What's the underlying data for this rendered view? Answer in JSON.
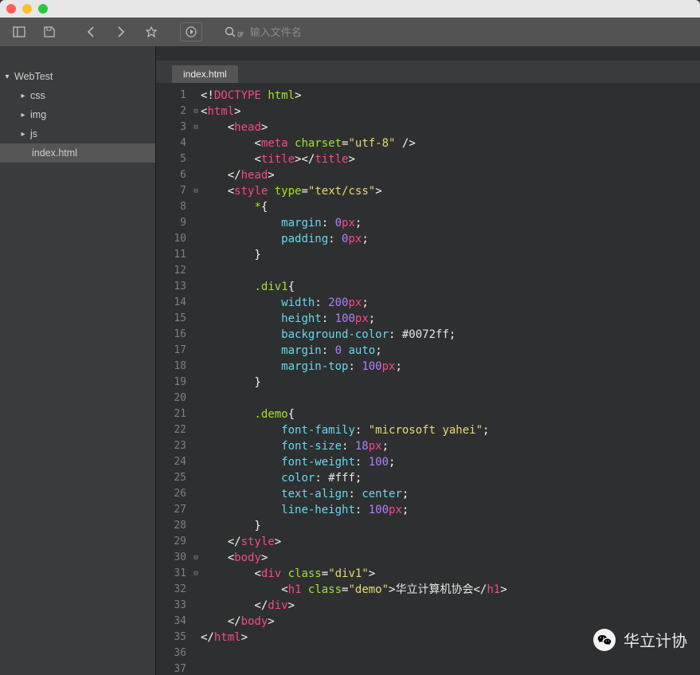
{
  "toolbar": {
    "search_prefix": "QF",
    "search_placeholder": "输入文件名"
  },
  "sidebar": {
    "project": "WebTest",
    "items": [
      "css",
      "img",
      "js"
    ],
    "file": "index.html"
  },
  "tab": {
    "label": "index.html"
  },
  "code": {
    "lines": [
      {
        "n": 1,
        "fold": "",
        "html": "<span class='w'>&lt;!</span><span class='tg'>DOCTYPE</span><span class='w'> </span><span class='at'>html</span><span class='w'>&gt;</span>"
      },
      {
        "n": 2,
        "fold": "⊟",
        "html": "<span class='w'>&lt;</span><span class='tg'>html</span><span class='w'>&gt;</span>"
      },
      {
        "n": 3,
        "fold": "⊟",
        "html": "<span class='w'>    &lt;</span><span class='tg'>head</span><span class='w'>&gt;</span>"
      },
      {
        "n": 4,
        "fold": "",
        "html": "<span class='w'>        &lt;</span><span class='tg'>meta</span><span class='w'> </span><span class='at'>charset</span><span class='w'>=</span><span class='st'>\"utf-8\"</span><span class='w'> /&gt;</span>"
      },
      {
        "n": 5,
        "fold": "",
        "html": "<span class='w'>        &lt;</span><span class='tg'>title</span><span class='w'>&gt;&lt;/</span><span class='tg'>title</span><span class='w'>&gt;</span>"
      },
      {
        "n": 6,
        "fold": "",
        "html": "<span class='w'>    &lt;/</span><span class='tg'>head</span><span class='w'>&gt;</span>"
      },
      {
        "n": 7,
        "fold": "⊟",
        "html": "<span class='w'>    &lt;</span><span class='tg'>style</span><span class='w'> </span><span class='at'>type</span><span class='w'>=</span><span class='st'>\"text/css\"</span><span class='w'>&gt;</span>"
      },
      {
        "n": 8,
        "fold": "",
        "html": "<span class='w'>        </span><span class='sel'>*</span><span class='w'>{</span>"
      },
      {
        "n": 9,
        "fold": "",
        "html": "<span class='w'>            </span><span class='prop'>margin</span><span class='w'>: </span><span class='num'>0</span><span class='kw'>px</span><span class='w'>;</span>"
      },
      {
        "n": 10,
        "fold": "",
        "html": "<span class='w'>            </span><span class='prop'>padding</span><span class='w'>: </span><span class='num'>0</span><span class='kw'>px</span><span class='w'>;</span>"
      },
      {
        "n": 11,
        "fold": "",
        "html": "<span class='w'>        }</span>"
      },
      {
        "n": 12,
        "fold": "",
        "html": "<span class='w'>        </span>"
      },
      {
        "n": 13,
        "fold": "",
        "html": "<span class='w'>        </span><span class='sel'>.div1</span><span class='w'>{</span>"
      },
      {
        "n": 14,
        "fold": "",
        "html": "<span class='w'>            </span><span class='prop'>width</span><span class='w'>: </span><span class='num'>200</span><span class='kw'>px</span><span class='w'>;</span>"
      },
      {
        "n": 15,
        "fold": "",
        "html": "<span class='w'>            </span><span class='prop'>height</span><span class='w'>: </span><span class='num'>100</span><span class='kw'>px</span><span class='w'>;</span>"
      },
      {
        "n": 16,
        "fold": "",
        "html": "<span class='w'>            </span><span class='prop'>background-color</span><span class='w'>: </span><span class='col'>#0072ff</span><span class='w'>;</span>"
      },
      {
        "n": 17,
        "fold": "",
        "html": "<span class='w'>            </span><span class='prop'>margin</span><span class='w'>: </span><span class='num'>0</span><span class='w'> </span><span class='prop'>auto</span><span class='w'>;</span>"
      },
      {
        "n": 18,
        "fold": "",
        "html": "<span class='w'>            </span><span class='prop'>margin-top</span><span class='w'>: </span><span class='num'>100</span><span class='kw'>px</span><span class='w'>;</span>"
      },
      {
        "n": 19,
        "fold": "",
        "html": "<span class='w'>        }</span>"
      },
      {
        "n": 20,
        "fold": "",
        "html": "<span class='w'>        </span>"
      },
      {
        "n": 21,
        "fold": "",
        "html": "<span class='w'>        </span><span class='sel'>.demo</span><span class='w'>{</span>"
      },
      {
        "n": 22,
        "fold": "",
        "html": "<span class='w'>            </span><span class='prop'>font-family</span><span class='w'>: </span><span class='st'>\"microsoft yahei\"</span><span class='w'>;</span>"
      },
      {
        "n": 23,
        "fold": "",
        "html": "<span class='w'>            </span><span class='prop'>font-size</span><span class='w'>: </span><span class='num'>18</span><span class='kw'>px</span><span class='w'>;</span>"
      },
      {
        "n": 24,
        "fold": "",
        "html": "<span class='w'>            </span><span class='prop'>font-weight</span><span class='w'>: </span><span class='num'>100</span><span class='w'>;</span>"
      },
      {
        "n": 25,
        "fold": "",
        "html": "<span class='w'>            </span><span class='prop'>color</span><span class='w'>: </span><span class='col'>#fff</span><span class='w'>;</span>"
      },
      {
        "n": 26,
        "fold": "",
        "html": "<span class='w'>            </span><span class='prop'>text-align</span><span class='w'>: </span><span class='prop'>center</span><span class='w'>;</span>"
      },
      {
        "n": 27,
        "fold": "",
        "html": "<span class='w'>            </span><span class='prop'>line-height</span><span class='w'>: </span><span class='num'>100</span><span class='kw'>px</span><span class='w'>;</span>"
      },
      {
        "n": 28,
        "fold": "",
        "html": "<span class='w'>        }</span>"
      },
      {
        "n": 29,
        "fold": "",
        "html": "<span class='w'>    &lt;/</span><span class='tg'>style</span><span class='w'>&gt;</span>"
      },
      {
        "n": 30,
        "fold": "⊟",
        "html": "<span class='w'>    &lt;</span><span class='tg'>body</span><span class='w'>&gt;</span>"
      },
      {
        "n": 31,
        "fold": "⊟",
        "html": "<span class='w'>        &lt;</span><span class='tg'>div</span><span class='w'> </span><span class='at'>class</span><span class='w'>=</span><span class='st'>\"div1\"</span><span class='w'>&gt;</span>"
      },
      {
        "n": 32,
        "fold": "",
        "html": "<span class='w'>            &lt;</span><span class='tg'>h1</span><span class='w'> </span><span class='at'>class</span><span class='w'>=</span><span class='st'>\"demo\"</span><span class='w'>&gt;</span><span class='txt'>华立计算机协会</span><span class='w'>&lt;/</span><span class='tg'>h1</span><span class='w'>&gt;</span>"
      },
      {
        "n": 33,
        "fold": "",
        "html": "<span class='w'>        &lt;/</span><span class='tg'>div</span><span class='w'>&gt;</span>"
      },
      {
        "n": 34,
        "fold": "",
        "html": "<span class='w'>    &lt;/</span><span class='tg'>body</span><span class='w'>&gt;</span>"
      },
      {
        "n": 35,
        "fold": "",
        "html": "<span class='w'>&lt;/</span><span class='tg'>html</span><span class='w'>&gt;</span>"
      },
      {
        "n": 36,
        "fold": "",
        "html": ""
      },
      {
        "n": 37,
        "fold": "",
        "html": ""
      }
    ]
  },
  "watermark": {
    "text": "华立计协"
  }
}
